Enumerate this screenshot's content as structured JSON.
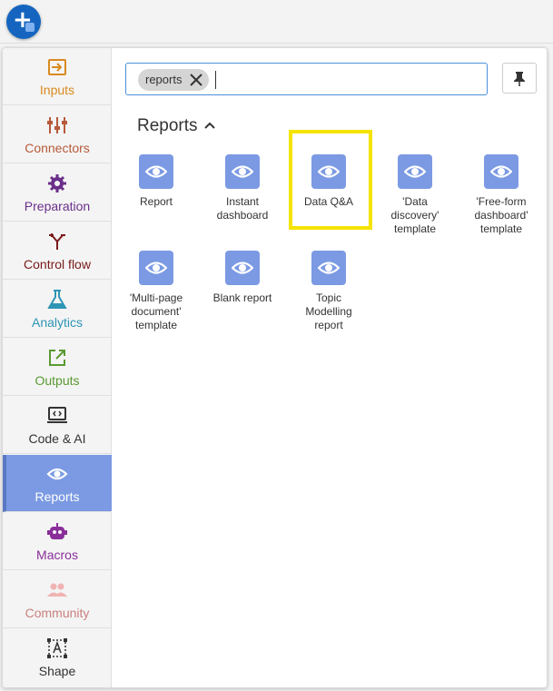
{
  "toolbar": {
    "add_button_icon": "plus-icon"
  },
  "sidebar": {
    "items": [
      {
        "label": "Inputs",
        "color": "#d98a1f",
        "icon": "input-arrow-icon"
      },
      {
        "label": "Connectors",
        "color": "#b75a3b",
        "icon": "connectors-icon"
      },
      {
        "label": "Preparation",
        "color": "#6b2f8a",
        "icon": "gear-icon"
      },
      {
        "label": "Control flow",
        "color": "#7a1a1a",
        "icon": "branch-icon"
      },
      {
        "label": "Analytics",
        "color": "#2f95b5",
        "icon": "flask-icon"
      },
      {
        "label": "Outputs",
        "color": "#5a9a32",
        "icon": "export-icon"
      },
      {
        "label": "Code & AI",
        "color": "#333333",
        "icon": "laptop-code-icon"
      },
      {
        "label": "Reports",
        "color": "#ffffff",
        "icon": "eye-icon",
        "active": true
      },
      {
        "label": "Macros",
        "color": "#8a2f9a",
        "icon": "robot-icon"
      },
      {
        "label": "Community",
        "color": "#c98080",
        "icon": "people-icon"
      },
      {
        "label": "Shape",
        "color": "#333333",
        "icon": "shape-text-icon"
      }
    ]
  },
  "search": {
    "chip_label": "reports",
    "value": ""
  },
  "section": {
    "title": "Reports"
  },
  "tiles": [
    {
      "label": "Report"
    },
    {
      "label": "Instant dashboard"
    },
    {
      "label": "Data Q&A"
    },
    {
      "label": "'Data discovery' template"
    },
    {
      "label": "'Free-form dashboard' template"
    },
    {
      "label": "'Multi-page document' template"
    },
    {
      "label": "Blank report"
    },
    {
      "label": "Topic Modelling report"
    }
  ],
  "colors": {
    "accent": "#7b9ae3",
    "highlight": "#f5e300",
    "add_button": "#1565c0"
  }
}
